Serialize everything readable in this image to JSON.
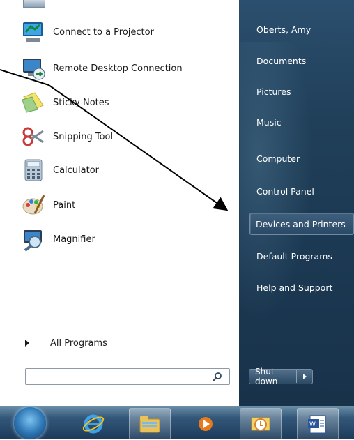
{
  "programs": [
    {
      "label": "Connect to a Projector",
      "icon": "projector-icon"
    },
    {
      "label": "Remote Desktop Connection",
      "icon": "remote-desktop-icon"
    },
    {
      "label": "Sticky Notes",
      "icon": "sticky-notes-icon"
    },
    {
      "label": "Snipping Tool",
      "icon": "scissors-icon"
    },
    {
      "label": "Calculator",
      "icon": "calculator-icon"
    },
    {
      "label": "Paint",
      "icon": "paint-palette-icon"
    },
    {
      "label": "Magnifier",
      "icon": "magnifier-icon"
    }
  ],
  "all_programs": "All Programs",
  "search": {
    "placeholder": "",
    "value": ""
  },
  "right_menu": [
    {
      "label": "Oberts, Amy"
    },
    {
      "label": "Documents"
    },
    {
      "label": "Pictures"
    },
    {
      "label": "Music"
    },
    {
      "label": "Computer"
    },
    {
      "label": "Control Panel"
    },
    {
      "label": "Devices and Printers",
      "selected": true
    },
    {
      "label": "Default Programs"
    },
    {
      "label": "Help and Support"
    }
  ],
  "shutdown": {
    "label": "Shut down"
  },
  "taskbar": {
    "items": [
      "start-orb-icon",
      "internet-explorer-icon",
      "file-explorer-icon",
      "media-player-icon",
      "outlook-icon",
      "word-icon"
    ]
  },
  "colors": {
    "accent": "#2b4f6e",
    "taskbar": "#34587a"
  }
}
